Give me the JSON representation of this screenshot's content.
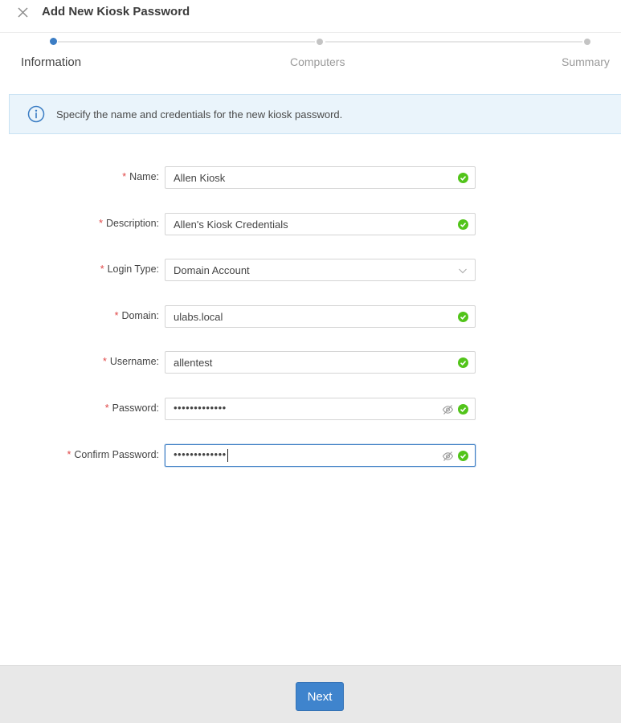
{
  "header": {
    "title": "Add New Kiosk Password",
    "close_icon": "close-icon"
  },
  "stepper": {
    "steps": [
      {
        "label": "Information",
        "active": true
      },
      {
        "label": "Computers",
        "active": false
      },
      {
        "label": "Summary",
        "active": false
      }
    ]
  },
  "banner": {
    "icon": "info-icon",
    "text": "Specify the name and credentials for the new kiosk password."
  },
  "form": {
    "required_mark": "*",
    "fields": [
      {
        "label": "Name:",
        "value": "Allen Kiosk",
        "type": "text",
        "valid": true
      },
      {
        "label": "Description:",
        "value": "Allen's Kiosk Credentials",
        "type": "text",
        "valid": true
      },
      {
        "label": "Login Type:",
        "value": "Domain Account",
        "type": "select"
      },
      {
        "label": "Domain:",
        "value": "ulabs.local",
        "type": "text",
        "valid": true
      },
      {
        "label": "Username:",
        "value": "allentest",
        "type": "text",
        "valid": true
      },
      {
        "label": "Password:",
        "value": "•••••••••••••",
        "type": "password",
        "valid": true
      },
      {
        "label": "Confirm Password:",
        "value": "•••••••••••••",
        "type": "password",
        "valid": true,
        "focused": true
      }
    ]
  },
  "footer": {
    "next_label": "Next"
  },
  "colors": {
    "accent": "#3f84cd",
    "valid": "#52c41a",
    "required": "#e04848",
    "banner_bg": "#eaf4fb"
  }
}
